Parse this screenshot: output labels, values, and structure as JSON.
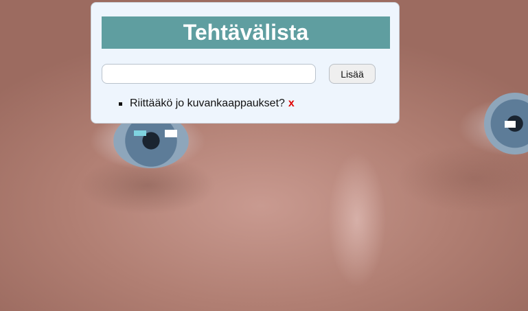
{
  "app": {
    "title": "Tehtävälista"
  },
  "form": {
    "input_value": "",
    "input_placeholder": "",
    "add_label": "Lisää"
  },
  "tasks": [
    {
      "text": "Riittääkö jo kuvankaappaukset?",
      "delete_label": "x"
    }
  ],
  "colors": {
    "title_bar": "#5f9ea0",
    "panel_bg": "#eef5fd",
    "delete": "#e00000"
  },
  "icons": {
    "background": "face-photo",
    "delete": "delete-x-icon",
    "bullet": "square-bullet-icon"
  }
}
